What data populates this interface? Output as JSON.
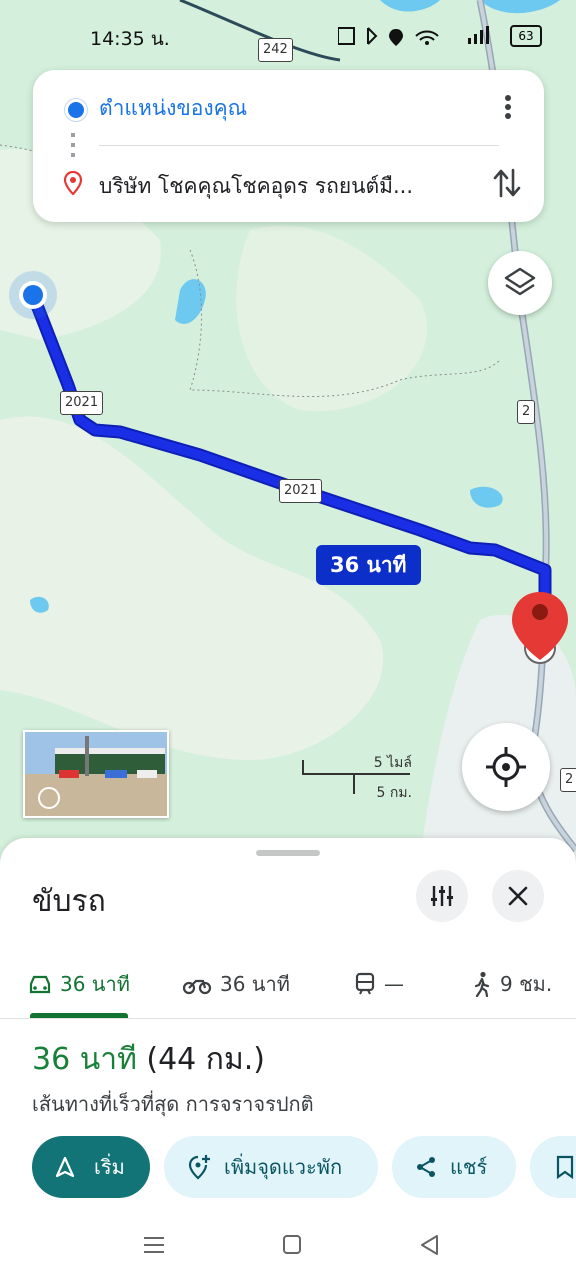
{
  "status_bar": {
    "time": "14:35 น.",
    "icons": [
      "tiktok-icon",
      "app-icon",
      "nfc-icon",
      "bluetooth-icon",
      "location-icon",
      "wifi-icon",
      "volte-icon",
      "signal-icon"
    ],
    "battery": "63"
  },
  "search_card": {
    "origin": "ตำแหน่งของคุณ",
    "destination": "บริษัท โชคคุณโชคอุดร รถยนต์มื..."
  },
  "map": {
    "eta_label": "36 นาที",
    "road_labels": [
      "242",
      "2021",
      "2021",
      "2",
      "2"
    ],
    "scale_top": "5 ไมล์",
    "scale_bottom": "5 กม."
  },
  "sheet": {
    "title": "ขับรถ",
    "modes": [
      {
        "icon": "car-icon",
        "label": "36 นาที",
        "active": true
      },
      {
        "icon": "motorcycle-icon",
        "label": "36 นาที",
        "active": false
      },
      {
        "icon": "train-icon",
        "label": "—",
        "active": false
      },
      {
        "icon": "walk-icon",
        "label": "9 ชม.",
        "active": false
      }
    ],
    "summary_time": "36 นาที",
    "summary_distance": "(44 กม.)",
    "summary_sub": "เส้นทางที่เร็วที่สุด การจราจรปกติ",
    "actions": [
      "เริ่ม",
      "เพิ่มจุดแวะพัก",
      "แชร์"
    ]
  },
  "colors": {
    "route": "#1a2ee6",
    "accent_green": "#188038",
    "primary_button": "#137477",
    "map_bg": "#d6f1de"
  }
}
